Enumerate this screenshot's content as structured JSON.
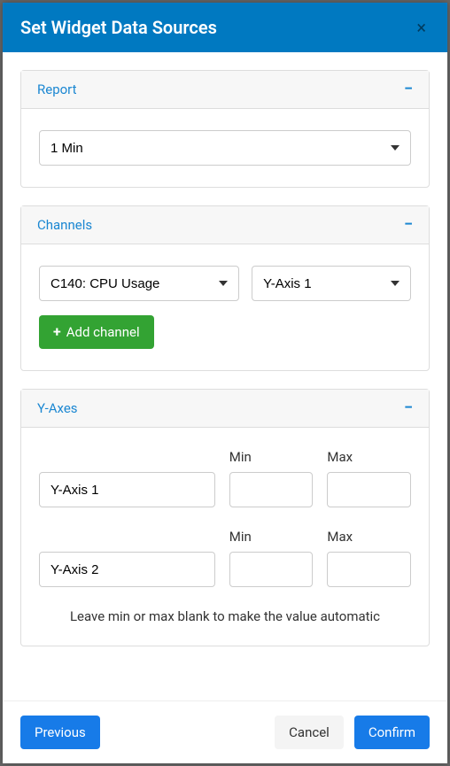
{
  "modal": {
    "title": "Set Widget Data Sources"
  },
  "report": {
    "section_title": "Report",
    "selected": "1 Min"
  },
  "channels": {
    "section_title": "Channels",
    "channel_selected": "C140: CPU Usage",
    "axis_selected": "Y-Axis 1",
    "add_label": "Add channel"
  },
  "yaxes": {
    "section_title": "Y-Axes",
    "min_label": "Min",
    "max_label": "Max",
    "rows": [
      {
        "name": "Y-Axis 1",
        "min": "",
        "max": ""
      },
      {
        "name": "Y-Axis 2",
        "min": "",
        "max": ""
      }
    ],
    "hint": "Leave min or max blank to make the value automatic"
  },
  "footer": {
    "previous": "Previous",
    "cancel": "Cancel",
    "confirm": "Confirm"
  }
}
